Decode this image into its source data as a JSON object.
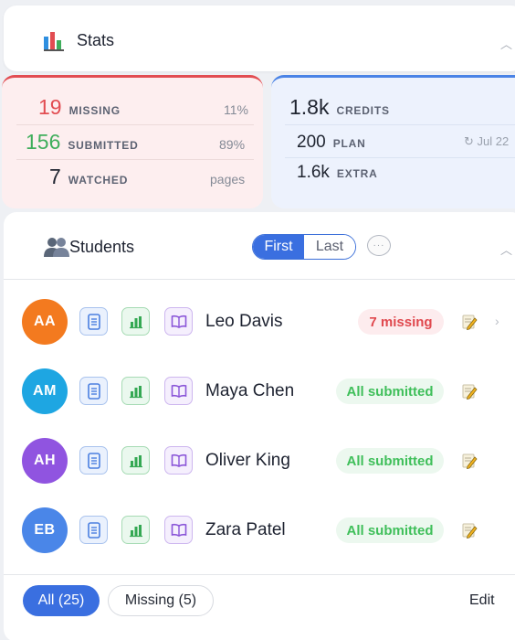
{
  "stats": {
    "title": "Stats",
    "collapse_icon": "caret-up-icon",
    "missing": {
      "value": "19",
      "label": "MISSING",
      "right": "11%",
      "color": "#e24d52"
    },
    "submitted": {
      "value": "156",
      "label": "SUBMITTED",
      "right": "89%",
      "color": "#3fae5c"
    },
    "watched": {
      "value": "7",
      "label": "WATCHED",
      "right": "pages",
      "color": "#1f2430"
    },
    "credits": {
      "value": "1.8k",
      "label": "CREDITS"
    },
    "plan": {
      "value": "200",
      "label": "PLAN",
      "right": "↻ Jul 22"
    },
    "extra": {
      "value": "1.6k",
      "label": "EXTRA"
    }
  },
  "students_section": {
    "title": "Students",
    "sort_first": "First",
    "sort_last": "Last",
    "comment_icon": "speech-bubble-icon",
    "rows": [
      {
        "initials": "AA",
        "name": "Leo Davis",
        "status": "7 missing",
        "status_type": "missing",
        "avatar_color": "#f37a1f"
      },
      {
        "initials": "AM",
        "name": "Maya Chen",
        "status": "All submitted",
        "status_type": "ok",
        "avatar_color": "#1ea6e2"
      },
      {
        "initials": "AH",
        "name": "Oliver King",
        "status": "All submitted",
        "status_type": "ok",
        "avatar_color": "#9054e0"
      },
      {
        "initials": "EB",
        "name": "Zara Patel",
        "status": "All submitted",
        "status_type": "ok",
        "avatar_color": "#4a86e8"
      }
    ]
  },
  "footer": {
    "filter_all": "All (25)",
    "filter_missing": "Missing (5)",
    "edit": "Edit"
  },
  "colors": {
    "accent": "#3a6fe0",
    "missing_red": "#e24d52",
    "submitted_green": "#3fbf5a"
  }
}
